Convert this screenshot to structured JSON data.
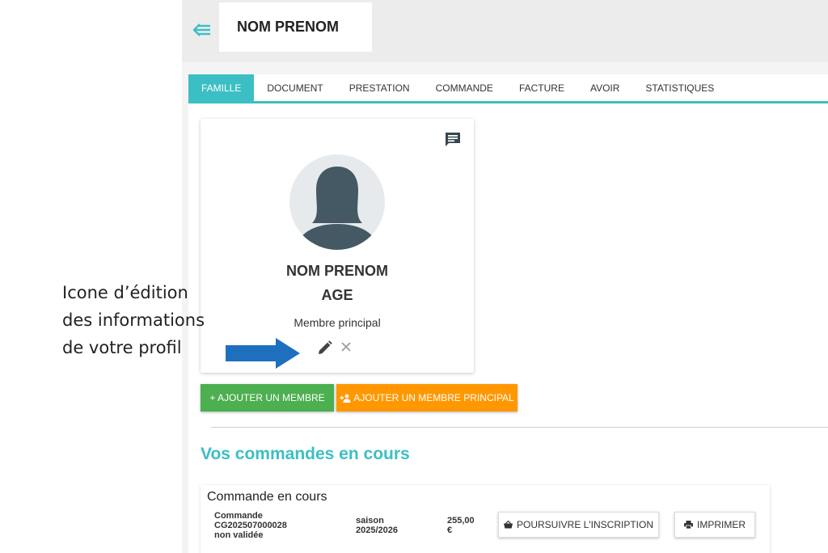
{
  "header": {
    "title": "NOM PRENOM",
    "back_icon": "arrow-back-icon"
  },
  "tabs": [
    {
      "label": "FAMILLE",
      "active": true
    },
    {
      "label": "DOCUMENT",
      "active": false
    },
    {
      "label": "PRESTATION",
      "active": false
    },
    {
      "label": "COMMANDE",
      "active": false
    },
    {
      "label": "FACTURE",
      "active": false
    },
    {
      "label": "AVOIR",
      "active": false
    },
    {
      "label": "STATISTIQUES",
      "active": false
    }
  ],
  "member_card": {
    "name": "NOM PRENOM",
    "age": "AGE",
    "role": "Membre principal",
    "icons": [
      "comment-icon",
      "avatar-female-icon",
      "pencil-icon",
      "close-icon"
    ]
  },
  "actions": {
    "add_member": "+ AJOUTER UN MEMBRE",
    "add_main_member": "AJOUTER UN MEMBRE PRINCIPAL"
  },
  "orders": {
    "section_title": "Vos commandes en cours",
    "heading": "Commande en cours",
    "row": {
      "order_label": "Commande",
      "order_id": "CG202507000028",
      "order_status": "non validée",
      "season_label": "saison",
      "season_value": "2025/2026",
      "price": "255,00",
      "currency": "€",
      "continue_label": "POURSUIVRE L'INSCRIPTION",
      "print_label": "IMPRIMER"
    }
  },
  "annotation": {
    "lines": [
      "Icone d’édition",
      "des informations",
      "de votre profil"
    ]
  },
  "colors": {
    "accent": "#3bbfc4",
    "green": "#4caf50",
    "orange": "#ff9800",
    "arrow": "#1f6fbf"
  }
}
